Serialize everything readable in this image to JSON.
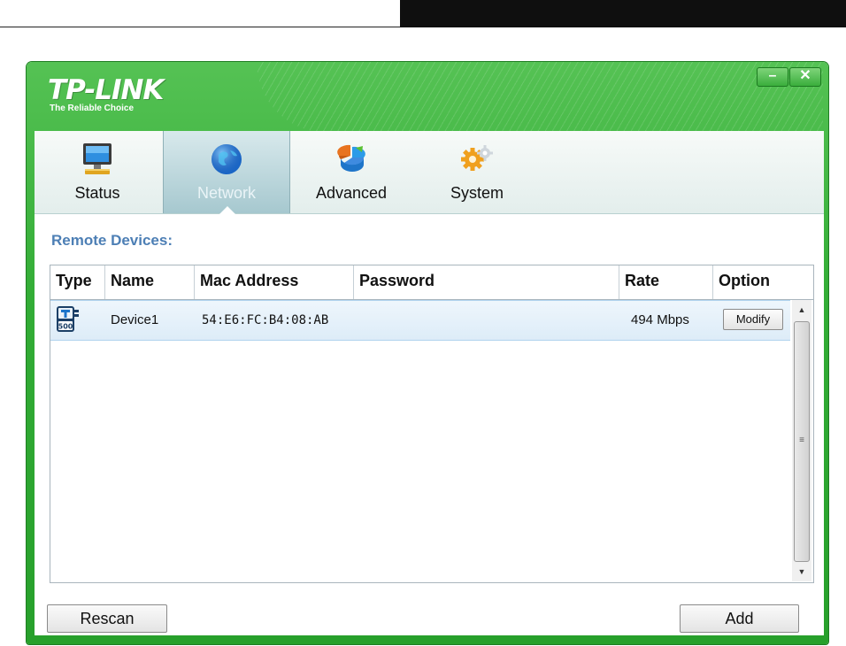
{
  "window": {
    "brand": "TP-LINK",
    "tagline": "The Reliable Choice",
    "minimize_glyph": "–",
    "close_glyph": "✕"
  },
  "tabs": [
    {
      "label": "Status",
      "icon": "monitor-icon"
    },
    {
      "label": "Network",
      "icon": "globe-icon",
      "active": true
    },
    {
      "label": "Advanced",
      "icon": "pie-chart-icon"
    },
    {
      "label": "System",
      "icon": "gear-icon"
    }
  ],
  "remote_devices": {
    "title": "Remote Devices:",
    "columns": [
      "Type",
      "Name",
      "Mac Address",
      "Password",
      "Rate",
      "Option"
    ],
    "rows": [
      {
        "type_icon": "powerline-adapter-icon",
        "name": "Device1",
        "mac": "54:E6:FC:B4:08:AB",
        "password": "",
        "rate": "494 Mbps",
        "option": "Modify"
      }
    ]
  },
  "buttons": {
    "rescan": "Rescan",
    "add": "Add"
  },
  "colors": {
    "window_green": "#33ad36",
    "section_title": "#4d7fb5",
    "selected_row": "#ddecf8"
  }
}
